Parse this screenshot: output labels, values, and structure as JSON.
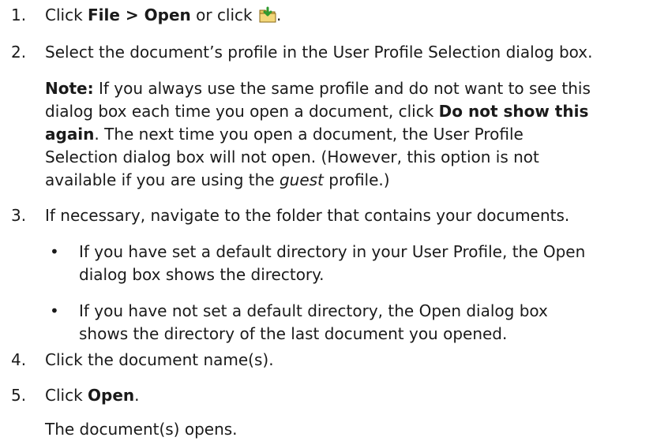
{
  "steps": [
    {
      "number": "1.",
      "pre": "Click ",
      "bold1": "File > Open",
      "mid": " or click ",
      "icon": "open-folder-green-arrow-icon",
      "post": "."
    },
    {
      "number": "2.",
      "text": "Select the document’s profile in the User Profile Selection dialog box."
    },
    {
      "number": "3.",
      "text": "If necessary, navigate to the folder that contains your documents."
    },
    {
      "number": "4.",
      "text": "Click the document name(s)."
    },
    {
      "number": "5.",
      "pre": "Click ",
      "bold": "Open",
      "post": "."
    }
  ],
  "note": {
    "label": "Note:",
    "line1": " If you always use the same profile and do not want to see this",
    "line2a": "dialog box each time you open a document, click ",
    "bold_a": "Do not show this",
    "bold_b": "again",
    "line3": ". The next time you open a document, the User Profile",
    "line4": "Selection dialog box will not open. (However, this option is not",
    "line5a": "available if you are using the ",
    "italic": "guest",
    "line5b": " profile.)"
  },
  "bullets": [
    {
      "dot": "•",
      "line1": "If you have set a default directory in your User Profile, the Open",
      "line2": "dialog box shows the directory."
    },
    {
      "dot": "•",
      "line1": "If you have not set a default directory, the Open dialog box",
      "line2": "shows the directory of the last document you opened."
    }
  ],
  "result": "The document(s) opens."
}
